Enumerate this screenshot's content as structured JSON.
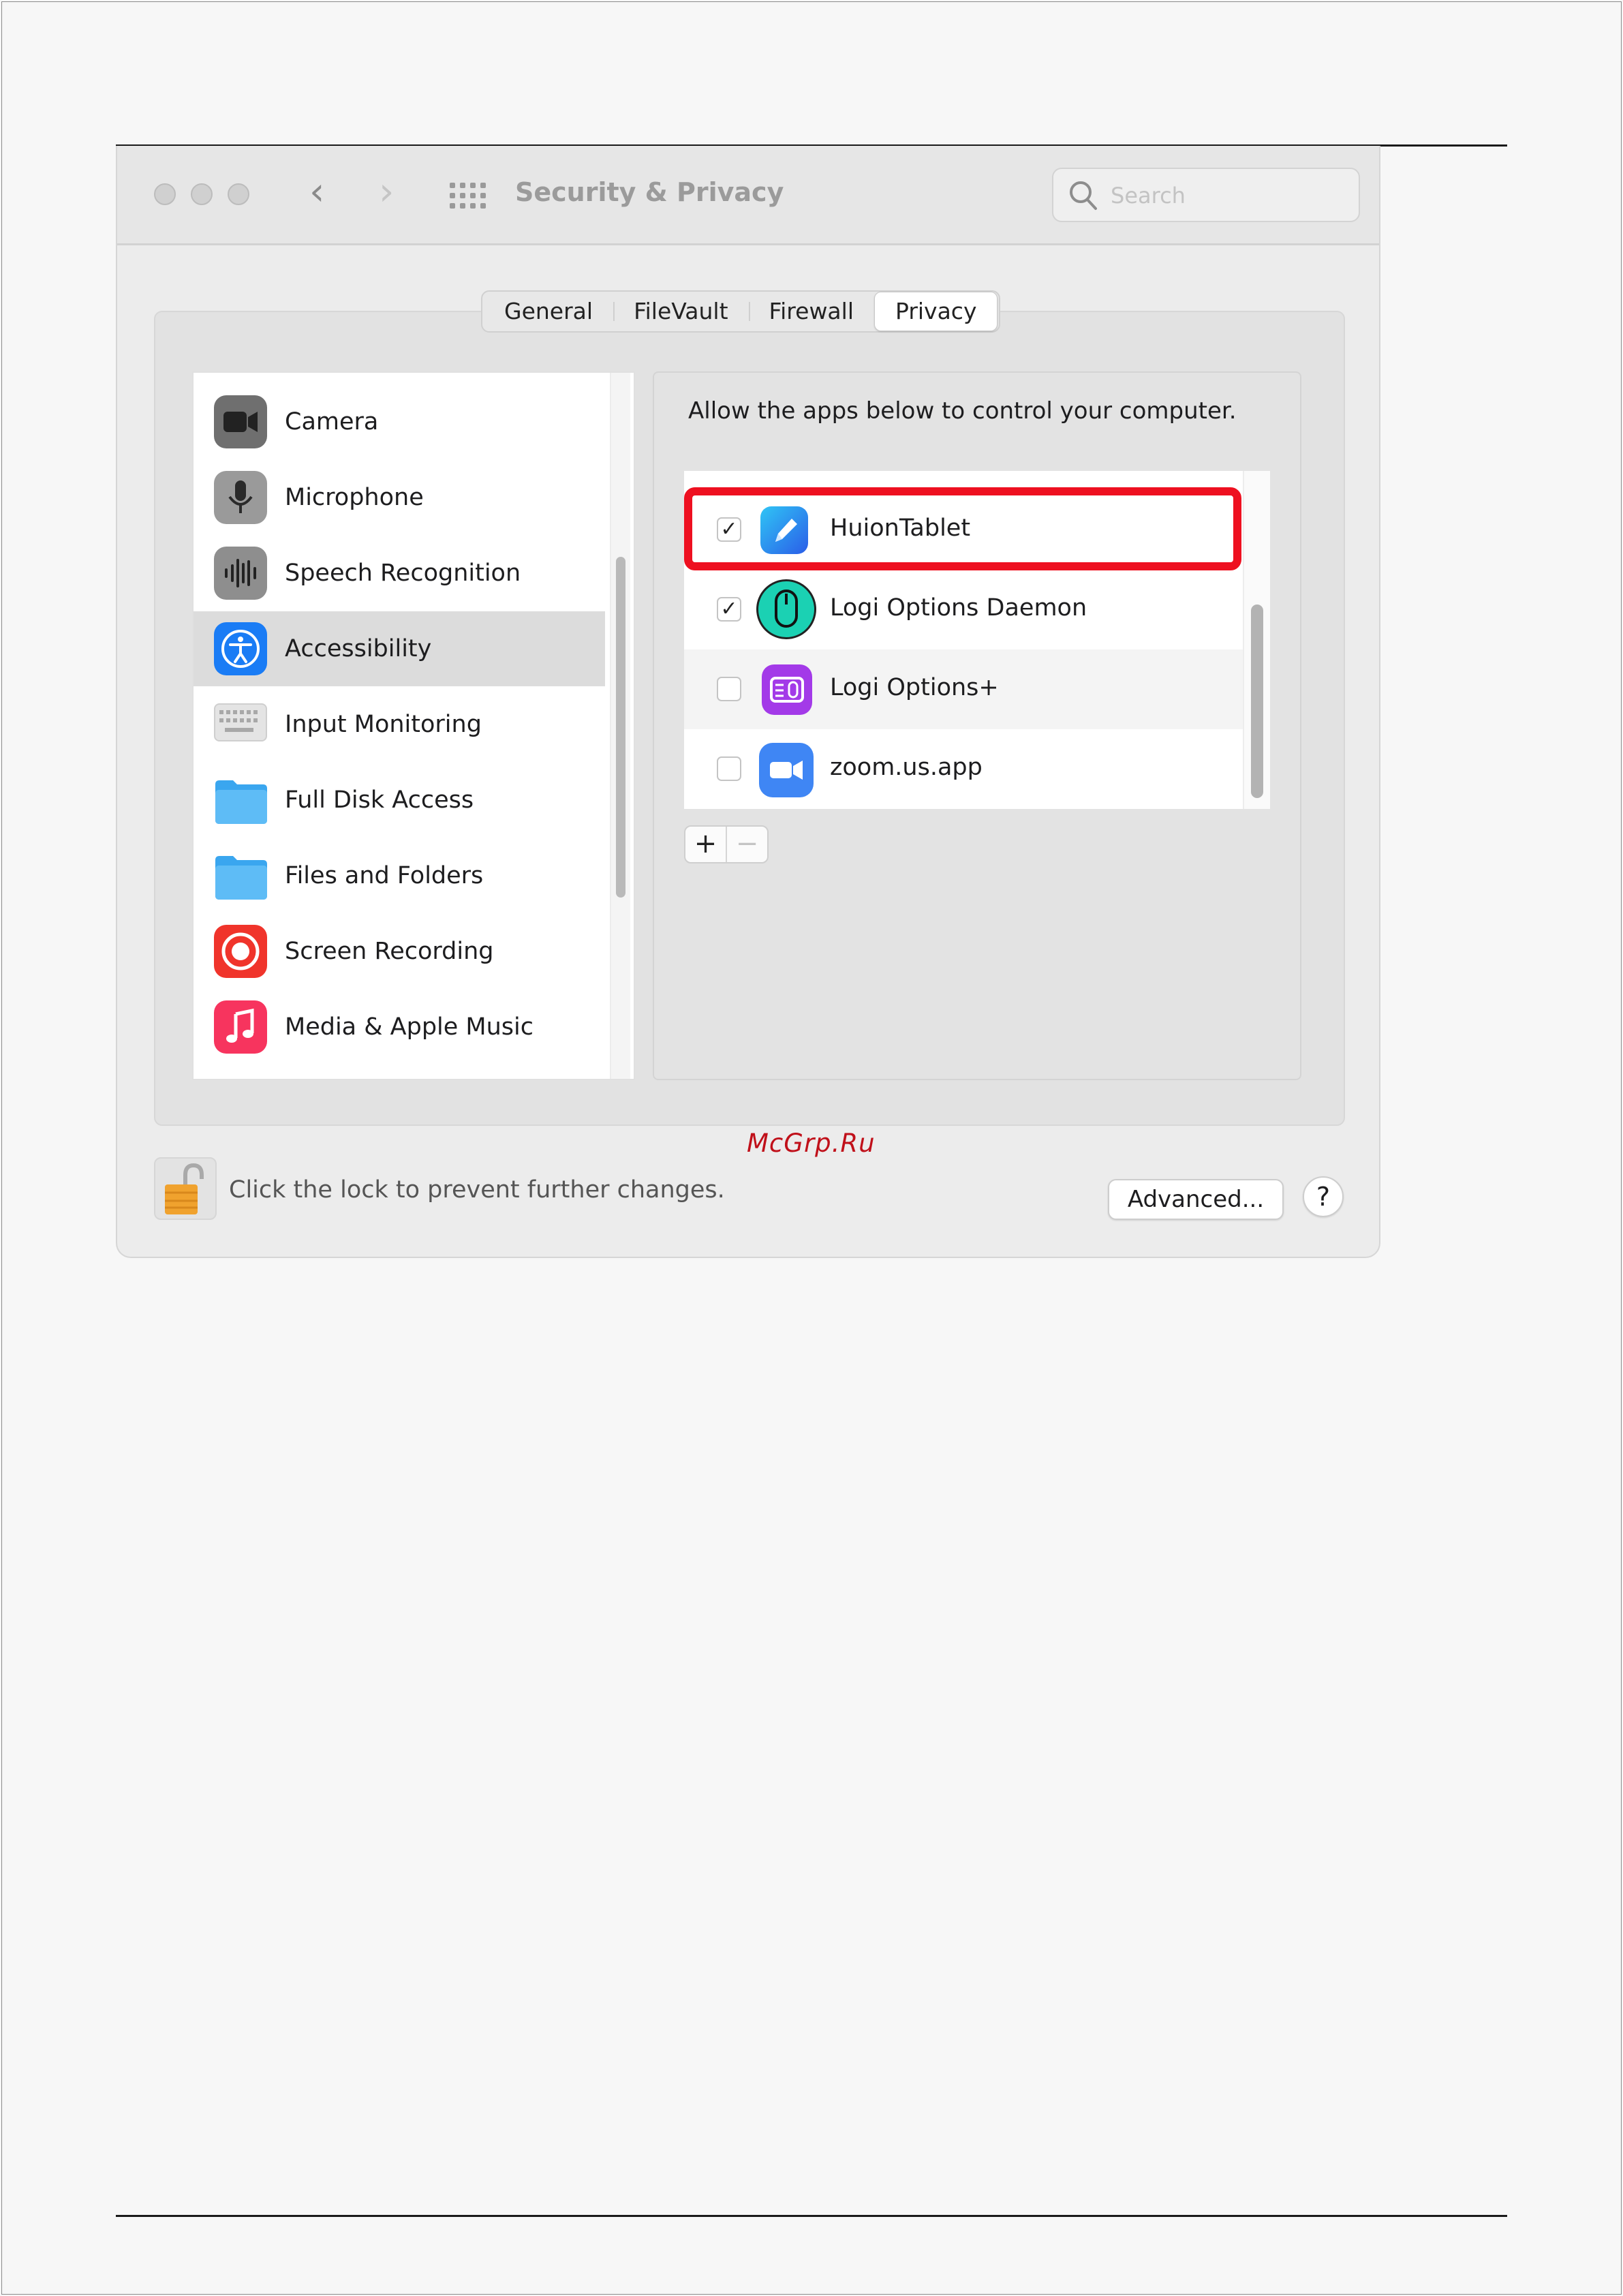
{
  "window": {
    "title": "Security & Privacy",
    "search_placeholder": "Search"
  },
  "tabs": [
    {
      "label": "General",
      "active": false
    },
    {
      "label": "FileVault",
      "active": false
    },
    {
      "label": "Firewall",
      "active": false
    },
    {
      "label": "Privacy",
      "active": true
    }
  ],
  "sidebar": {
    "items": [
      {
        "label": "Camera",
        "icon": "camera-icon",
        "selected": false
      },
      {
        "label": "Microphone",
        "icon": "microphone-icon",
        "selected": false
      },
      {
        "label": "Speech Recognition",
        "icon": "speech-recognition-icon",
        "selected": false
      },
      {
        "label": "Accessibility",
        "icon": "accessibility-icon",
        "selected": true
      },
      {
        "label": "Input Monitoring",
        "icon": "keyboard-icon",
        "selected": false
      },
      {
        "label": "Full Disk Access",
        "icon": "folder-icon",
        "selected": false
      },
      {
        "label": "Files and Folders",
        "icon": "folder-icon",
        "selected": false
      },
      {
        "label": "Screen Recording",
        "icon": "screen-recording-icon",
        "selected": false
      },
      {
        "label": "Media & Apple Music",
        "icon": "music-icon",
        "selected": false
      }
    ]
  },
  "detail": {
    "caption": "Allow the apps below to control your computer.",
    "apps": [
      {
        "name": "HuionTablet",
        "checked": true,
        "icon": "huion-tablet-icon",
        "highlighted": true
      },
      {
        "name": "Logi Options Daemon",
        "checked": true,
        "icon": "logi-mouse-icon",
        "highlighted": false
      },
      {
        "name": "Logi Options+",
        "checked": false,
        "icon": "logi-options-plus-icon",
        "highlighted": false
      },
      {
        "name": "zoom.us.app",
        "checked": false,
        "icon": "zoom-icon",
        "highlighted": false
      }
    ],
    "add_label": "+",
    "remove_label": "−"
  },
  "watermark": "McGrp.Ru",
  "footer": {
    "lock_text": "Click the lock to prevent further changes.",
    "advanced_label": "Advanced...",
    "help_label": "?"
  },
  "colors": {
    "highlight": "#ee1020",
    "accent": "#1a7cf5"
  }
}
